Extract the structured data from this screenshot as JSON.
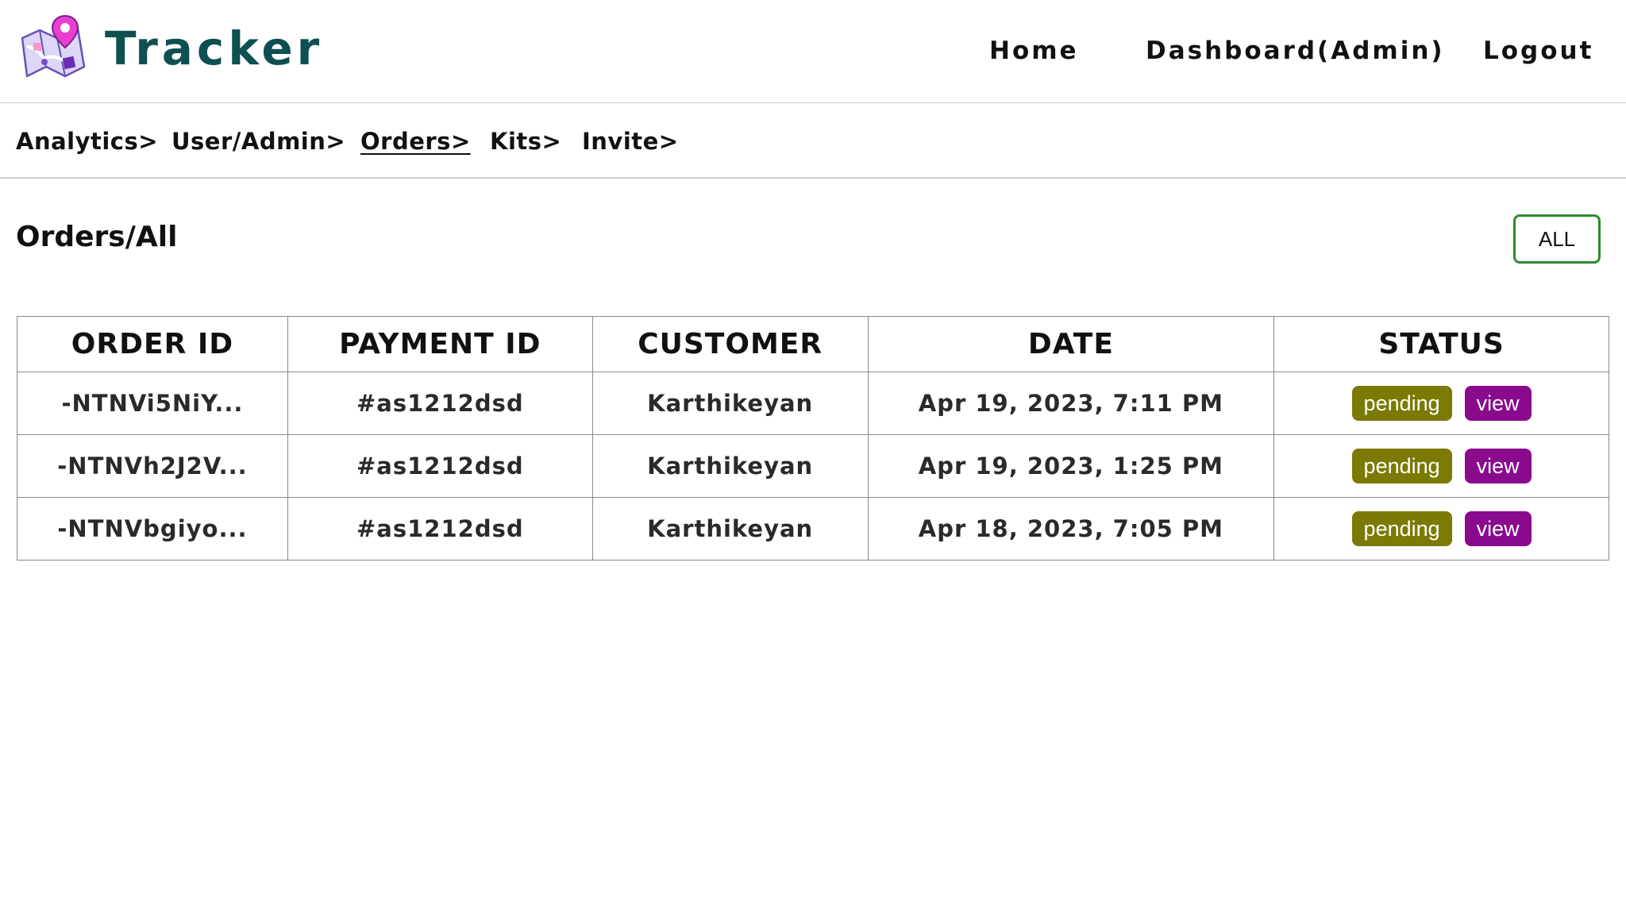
{
  "header": {
    "brand": "Tracker",
    "logo_icon": "map-pin-icon",
    "nav": {
      "home": "Home",
      "dashboard": "Dashboard(Admin)",
      "logout": "Logout"
    }
  },
  "subnav": {
    "items": [
      {
        "label": "Analytics>"
      },
      {
        "label": "User/Admin>"
      },
      {
        "label": "Orders>",
        "active": true
      },
      {
        "label": "Kits>"
      },
      {
        "label": "Invite>"
      }
    ]
  },
  "page": {
    "title": "Orders/All",
    "filter_button": "ALL"
  },
  "table": {
    "headers": [
      "ORDER ID",
      "PAYMENT ID",
      "CUSTOMER",
      "DATE",
      "STATUS"
    ],
    "rows": [
      {
        "order_id": "-NTNVi5NiY...",
        "payment_id": "#as1212dsd",
        "customer": "Karthikeyan",
        "date": "Apr 19, 2023, 7:11 PM",
        "status": "pending",
        "action": "view"
      },
      {
        "order_id": "-NTNVh2J2V...",
        "payment_id": "#as1212dsd",
        "customer": "Karthikeyan",
        "date": "Apr 19, 2023, 1:25 PM",
        "status": "pending",
        "action": "view"
      },
      {
        "order_id": "-NTNVbgiyo...",
        "payment_id": "#as1212dsd",
        "customer": "Karthikeyan",
        "date": "Apr 18, 2023, 7:05 PM",
        "status": "pending",
        "action": "view"
      }
    ]
  },
  "colors": {
    "brand": "#0e4f52",
    "status_pending": "#7b7a04",
    "view_button": "#8a0a8e",
    "filter_border": "#2e8b2e"
  }
}
